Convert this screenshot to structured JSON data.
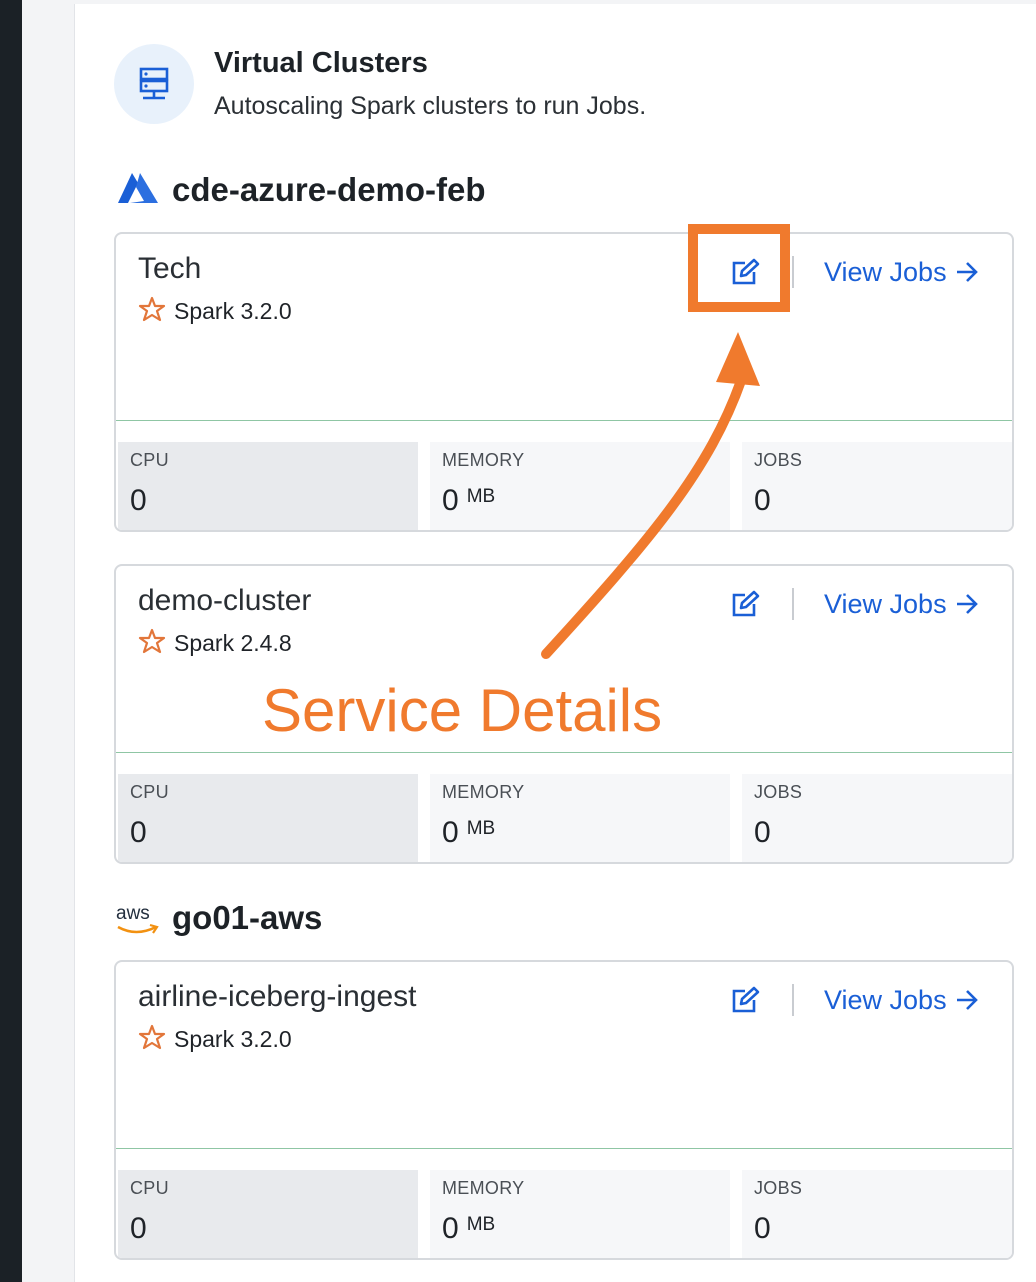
{
  "header": {
    "title": "Virtual Clusters",
    "subtitle": "Autoscaling Spark clusters to run Jobs.",
    "icon": "server-icon"
  },
  "groups": [
    {
      "name": "cde-azure-demo-feb",
      "provider_icon": "azure-logo-icon",
      "clusters": [
        {
          "name": "Tech",
          "spark_version": "Spark 3.2.0",
          "view_jobs_label": "View Jobs",
          "stats": {
            "cpu_label": "CPU",
            "cpu_value": "0",
            "memory_label": "MEMORY",
            "memory_value": "0",
            "memory_unit": "MB",
            "jobs_label": "JOBS",
            "jobs_value": "0"
          }
        },
        {
          "name": "demo-cluster",
          "spark_version": "Spark 2.4.8",
          "view_jobs_label": "View Jobs",
          "stats": {
            "cpu_label": "CPU",
            "cpu_value": "0",
            "memory_label": "MEMORY",
            "memory_value": "0",
            "memory_unit": "MB",
            "jobs_label": "JOBS",
            "jobs_value": "0"
          }
        }
      ]
    },
    {
      "name": "go01-aws",
      "provider_icon": "aws-logo-icon",
      "provider_logo_text": "aws",
      "clusters": [
        {
          "name": "airline-iceberg-ingest",
          "spark_version": "Spark 3.2.0",
          "view_jobs_label": "View Jobs",
          "stats": {
            "cpu_label": "CPU",
            "cpu_value": "0",
            "memory_label": "MEMORY",
            "memory_value": "0",
            "memory_unit": "MB",
            "jobs_label": "JOBS",
            "jobs_value": "0"
          }
        }
      ]
    }
  ],
  "annotation": {
    "text": "Service Details",
    "color": "#f07a2d"
  },
  "colors": {
    "accent": "#1a5fd6",
    "spark": "#e2763a",
    "annotation": "#f07a2d"
  }
}
